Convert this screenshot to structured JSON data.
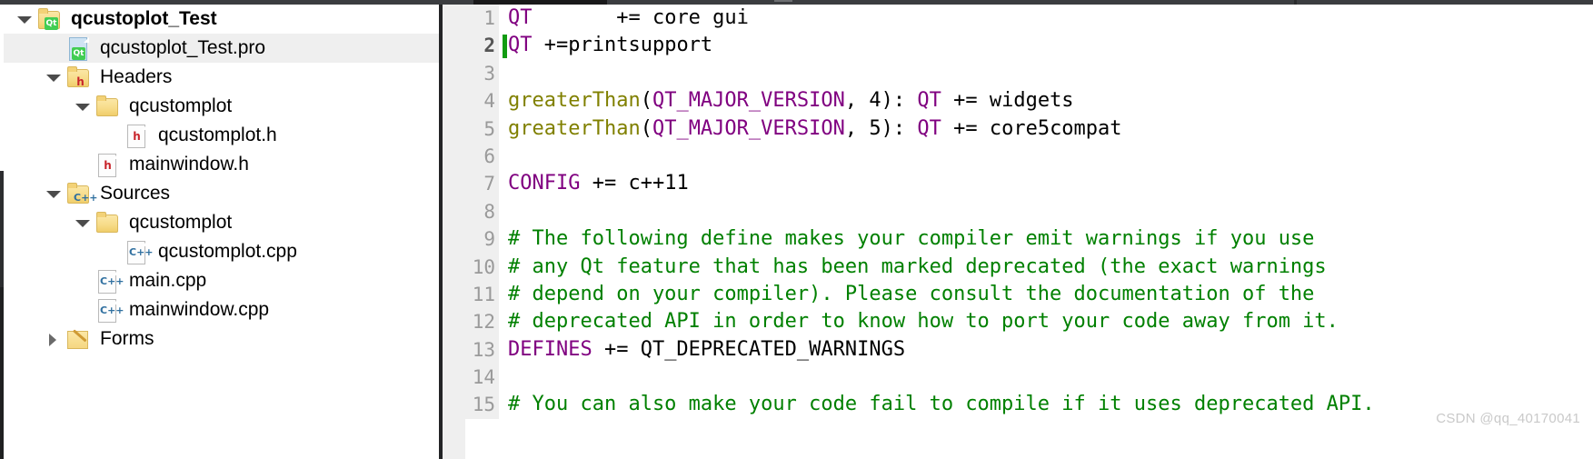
{
  "window": {
    "top_bar_color": "#3b3d40",
    "active_tab_color": "#19191a"
  },
  "project_tree": {
    "name": "project-explorer",
    "items": [
      {
        "label": "qcustoplot_Test",
        "indent": 0,
        "twisty": "open",
        "icon": "qt-folder-icon",
        "selected": false,
        "bold": true
      },
      {
        "label": "qcustoplot_Test.pro",
        "indent": 1,
        "twisty": "none",
        "icon": "qt-pro-file-icon",
        "selected": true,
        "bold": false
      },
      {
        "label": "Headers",
        "indent": 1,
        "twisty": "open",
        "icon": "headers-folder-icon",
        "selected": false,
        "bold": false
      },
      {
        "label": "qcustomplot",
        "indent": 2,
        "twisty": "open",
        "icon": "folder-icon",
        "selected": false,
        "bold": false
      },
      {
        "label": "qcustomplot.h",
        "indent": 3,
        "twisty": "none",
        "icon": "h-file-icon",
        "selected": false,
        "bold": false
      },
      {
        "label": "mainwindow.h",
        "indent": 2,
        "twisty": "none",
        "icon": "h-file-icon",
        "selected": false,
        "bold": false
      },
      {
        "label": "Sources",
        "indent": 1,
        "twisty": "open",
        "icon": "sources-folder-icon",
        "selected": false,
        "bold": false
      },
      {
        "label": "qcustomplot",
        "indent": 2,
        "twisty": "open",
        "icon": "folder-icon",
        "selected": false,
        "bold": false
      },
      {
        "label": "qcustomplot.cpp",
        "indent": 3,
        "twisty": "none",
        "icon": "cpp-file-icon",
        "selected": false,
        "bold": false
      },
      {
        "label": "main.cpp",
        "indent": 2,
        "twisty": "none",
        "icon": "cpp-file-icon",
        "selected": false,
        "bold": false
      },
      {
        "label": "mainwindow.cpp",
        "indent": 2,
        "twisty": "none",
        "icon": "cpp-file-icon",
        "selected": false,
        "bold": false
      },
      {
        "label": "Forms",
        "indent": 1,
        "twisty": "closed",
        "icon": "forms-folder-icon",
        "selected": false,
        "bold": false
      }
    ]
  },
  "editor": {
    "name": "qmake-project-file-editor",
    "language": "qmake",
    "cursor_line": 2,
    "colors": {
      "variable": "#800080",
      "function": "#808000",
      "comment": "#008000",
      "plain": "#000000",
      "gutter_bg": "#efefef",
      "line_number": "#9a9a9a",
      "cursor": "#129b12"
    },
    "lines": [
      {
        "n": "1",
        "tokens": [
          {
            "t": "QT",
            "c": "var"
          },
          {
            "t": "       += core gui",
            "c": "plain"
          }
        ]
      },
      {
        "n": "2",
        "tokens": [
          {
            "t": "QT",
            "c": "var"
          },
          {
            "t": " +=printsupport",
            "c": "plain"
          }
        ]
      },
      {
        "n": "3",
        "tokens": []
      },
      {
        "n": "4",
        "tokens": [
          {
            "t": "greaterThan",
            "c": "fn"
          },
          {
            "t": "(",
            "c": "plain"
          },
          {
            "t": "QT_MAJOR_VERSION",
            "c": "var"
          },
          {
            "t": ", 4): ",
            "c": "plain"
          },
          {
            "t": "QT",
            "c": "var"
          },
          {
            "t": " += widgets",
            "c": "plain"
          }
        ]
      },
      {
        "n": "5",
        "tokens": [
          {
            "t": "greaterThan",
            "c": "fn"
          },
          {
            "t": "(",
            "c": "plain"
          },
          {
            "t": "QT_MAJOR_VERSION",
            "c": "var"
          },
          {
            "t": ", 5): ",
            "c": "plain"
          },
          {
            "t": "QT",
            "c": "var"
          },
          {
            "t": " += core5compat",
            "c": "plain"
          }
        ]
      },
      {
        "n": "6",
        "tokens": []
      },
      {
        "n": "7",
        "tokens": [
          {
            "t": "CONFIG",
            "c": "var"
          },
          {
            "t": " += c++11",
            "c": "plain"
          }
        ]
      },
      {
        "n": "8",
        "tokens": []
      },
      {
        "n": "9",
        "tokens": [
          {
            "t": "# The following define makes your compiler emit warnings if you use",
            "c": "cmt"
          }
        ]
      },
      {
        "n": "10",
        "tokens": [
          {
            "t": "# any Qt feature that has been marked deprecated (the exact warnings",
            "c": "cmt"
          }
        ]
      },
      {
        "n": "11",
        "tokens": [
          {
            "t": "# depend on your compiler). Please consult the documentation of the",
            "c": "cmt"
          }
        ]
      },
      {
        "n": "12",
        "tokens": [
          {
            "t": "# deprecated API in order to know how to port your code away from it.",
            "c": "cmt"
          }
        ]
      },
      {
        "n": "13",
        "tokens": [
          {
            "t": "DEFINES",
            "c": "var"
          },
          {
            "t": " += QT_DEPRECATED_WARNINGS",
            "c": "plain"
          }
        ]
      },
      {
        "n": "14",
        "tokens": []
      },
      {
        "n": "15",
        "tokens": [
          {
            "t": "# You can also make your code fail to compile if it uses deprecated API.",
            "c": "cmt"
          }
        ]
      }
    ]
  },
  "watermark": {
    "text": "CSDN @qq_40170041"
  }
}
